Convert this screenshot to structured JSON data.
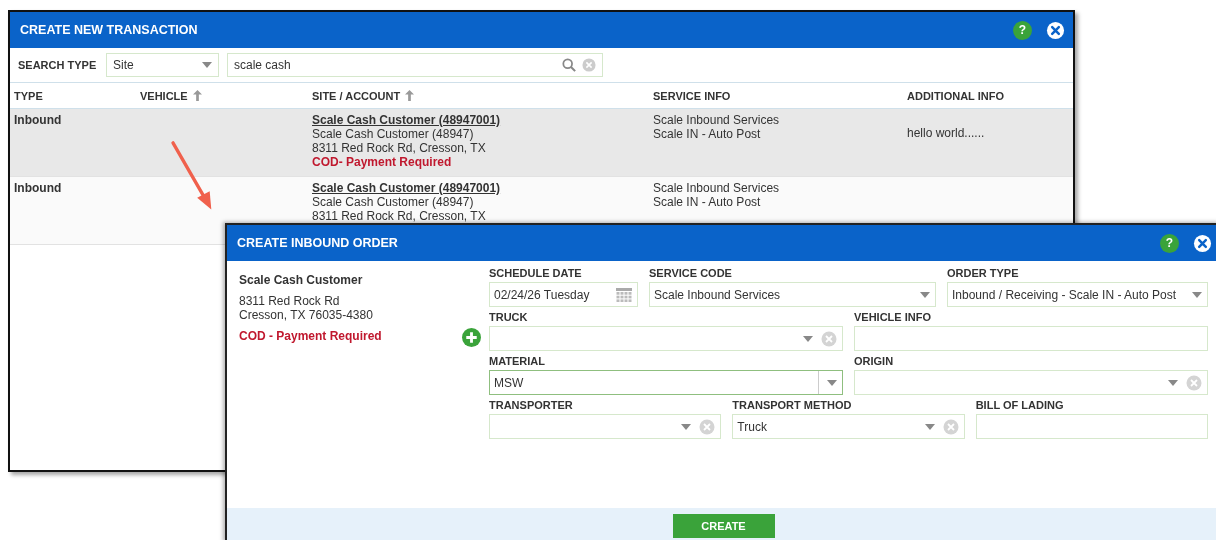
{
  "back_window": {
    "title": "CREATE NEW TRANSACTION",
    "help_label": "?",
    "search": {
      "label": "SEARCH TYPE",
      "type_value": "Site",
      "query": "scale cash"
    },
    "columns": [
      {
        "label": "TYPE",
        "sort_icon": false
      },
      {
        "label": "VEHICLE",
        "sort_icon": true
      },
      {
        "label": "SITE / ACCOUNT",
        "sort_icon": true
      },
      {
        "label": "SERVICE INFO",
        "sort_icon": false
      },
      {
        "label": "ADDITIONAL INFO",
        "sort_icon": false
      }
    ],
    "rows": [
      {
        "selected": true,
        "type": "Inbound",
        "account": "Scale Cash Customer (48947001)",
        "site_lines": [
          "Scale Cash Customer (48947)",
          "8311 Red Rock Rd, Cresson, TX"
        ],
        "alert": "COD- Payment Required",
        "service_lines": [
          "Scale Inbound Services",
          "Scale IN - Auto Post"
        ],
        "additional_info": "hello world......"
      },
      {
        "selected": false,
        "type": "Inbound",
        "account": "Scale Cash Customer (48947001)",
        "site_lines": [
          "Scale Cash Customer (48947)",
          "8311 Red Rock Rd, Cresson, TX"
        ],
        "service_lines": [
          "Scale Inbound Services",
          "Scale IN - Auto Post"
        ]
      }
    ]
  },
  "front_window": {
    "title": "CREATE INBOUND ORDER",
    "help_label": "?",
    "customer": {
      "name": "Scale Cash Customer",
      "address_lines": [
        "8311 Red Rock Rd",
        "Cresson, TX 76035-4380"
      ],
      "alert": "COD - Payment Required"
    },
    "field_rows": [
      [
        {
          "label": "SCHEDULE DATE",
          "kind": "date",
          "value": "02/24/26 Tuesday",
          "clearable": false,
          "focused": false
        },
        {
          "label": "SERVICE CODE",
          "kind": "select",
          "value": "Scale Inbound Services",
          "clearable": false,
          "focused": false
        },
        {
          "label": "ORDER TYPE",
          "kind": "select",
          "value": "Inbound / Receiving - Scale IN - Auto Post",
          "clearable": false,
          "focused": false
        }
      ],
      [
        {
          "label": "TRUCK",
          "kind": "select",
          "clearable": true,
          "focused": false,
          "add_button": true
        },
        {
          "label": "VEHICLE INFO",
          "kind": "text",
          "clearable": false,
          "focused": false
        }
      ],
      [
        {
          "label": "MATERIAL",
          "kind": "combo",
          "value": "MSW",
          "clearable": false,
          "focused": true
        },
        {
          "label": "ORIGIN",
          "kind": "select",
          "clearable": true,
          "focused": false
        }
      ],
      [
        {
          "label": "TRANSPORTER",
          "kind": "select",
          "clearable": true,
          "focused": false
        },
        {
          "label": "TRANSPORT METHOD",
          "kind": "select",
          "value": "Truck",
          "clearable": true,
          "focused": false
        },
        {
          "label": "BILL OF LADING",
          "kind": "text",
          "clearable": false,
          "focused": false
        }
      ]
    ],
    "create_button": "CREATE"
  }
}
